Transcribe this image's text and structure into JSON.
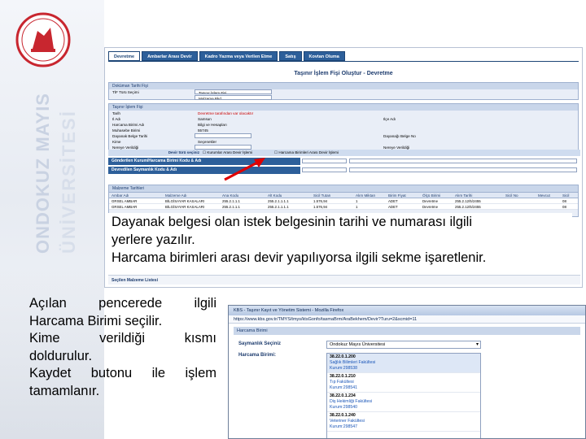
{
  "university": {
    "vertical_name_line1": "ONDOKUZ MAYIS",
    "vertical_name_line2": "ÜNİVERSİTESİ",
    "colors": {
      "logo_red": "#c8262f",
      "band_text": "#c9d2e2"
    }
  },
  "screen": {
    "tabs": [
      "Devretme",
      "Ambarlar Arası Devir",
      "Kadro Yazma veya Verilen Etme",
      "Satış",
      "Kovtan Oluma"
    ],
    "form_title": "Taşınır İşlem Fişi Oluştur - Devretme",
    "sections": {
      "doc_info": "Doküman Tarihi Fişi",
      "fis_info": "Taşınır İşlem Fişi"
    },
    "fields": [
      {
        "label": "TİF Türü Seçimi",
        "value": "Taşınır İşlem Fişi"
      },
      {
        "label": "Malzeme Bkd",
        "value": "Malzeme Bkd"
      },
      {
        "label": "Tarih",
        "value": "Devretme tarafından var olacaktır"
      },
      {
        "label": "Il Adı",
        "value": "Samsun"
      },
      {
        "label": "Harcama Birimi Adı",
        "value": "Bilgi ve Hesapları"
      },
      {
        "label": "Muhasebe Birimi",
        "value": "55745"
      },
      {
        "label": "Dayanak Belge Tarihi",
        "value": ""
      },
      {
        "label": "Kime",
        "value": "Seçenekler"
      },
      {
        "label": "Nereye Verildiği",
        "value": ""
      }
    ],
    "right_labels": [
      "Ilçe Adı",
      "Dayanağı Belge No",
      "Nereye Verildiği"
    ],
    "devir_row_label": "Devir türü seçiniz",
    "devir_options": [
      "Kurumlar Arası Devir İşlemi",
      "Harcama Birimleri Arası Devir İşlemi"
    ],
    "blue_bars": [
      "Gönderilen Kurum/Harcama Birimi Kodu & Adı",
      "Devredilen Saymanlık Kodu & Adı"
    ],
    "table_section": "Malzeme Tarihleri",
    "table_headers": [
      "Ambar Adı",
      "Malzeme Adı",
      "Ana Kodu",
      "Alt Kodu",
      "Sicil Tutarı",
      "Alım Miktarı",
      "Birim Fiyat",
      "Ölçü Birimi",
      "Alım Tarihi",
      "Sicil No",
      "Mevcut",
      "Sicil"
    ],
    "table_rows": [
      [
        "GRSEL AMBAR",
        "BİLGİSAYAR KASALARI",
        "255.2.1.1.1",
        "255.2.1.1.1.1",
        "1.576,94",
        "1",
        "ADET",
        "Devretme",
        "255.2.12/5/2455",
        "",
        "",
        "08"
      ],
      [
        "GRSEL AMBAR",
        "BİLGİSAYAR KASALARI",
        "255.2.1.1.1",
        "255.2.1.1.1.1",
        "1.576,94",
        "1",
        "ADET",
        "Devretme",
        "255.2.12/5/2455",
        "",
        "",
        "08"
      ]
    ],
    "bottom_strip": "Seçilen Malzeme Listesi"
  },
  "note": {
    "line1": "Dayanak belgesi olan istek belgesinin tarihi ve numarası ilgili",
    "line2": "yerlere yazılır.",
    "line3": "Harcama birimleri arası devir yapılıyorsa ilgili sekme işaretlenir."
  },
  "instructions": {
    "l1": "Açılan pencerede ilgili",
    "l2": "Harcama Birimi seçilir.",
    "l3": "Kime verildiği kısmı",
    "l4": "doldurulur.",
    "l5": "Kaydet butonu ile işlem",
    "l6": "tamamlanır."
  },
  "popup": {
    "title": "KBS - Taşınır Kayıt ve Yönetim Sistemi - Mozilla Firefox",
    "url": "https://www.kbs.gov.tr/TMYS/tmys/ktsGonfo/tasmaBrm/AraBekhem/Devir?Turu=2&scmid=11",
    "section": "Harcama Birimi",
    "saymanlik_label": "Saymanlık Seçiniz",
    "harcama_label": "Harcama Birimi:",
    "selected": "Ondokuz Mayıs Üniversitesi",
    "items": [
      {
        "code": "38.22.0.1.200",
        "name": "Sağlık Bilimleri Fakültesi",
        "kurum": "Kurum:298538"
      },
      {
        "code": "38.22.0.1.210",
        "name": "Tıp Fakültesi",
        "kurum": "Kurum:298541"
      },
      {
        "code": "38.22.0.1.234",
        "name": "Diş Hekimliği Fakültesi",
        "kurum": "Kurum:298540"
      },
      {
        "code": "38.22.0.1.240",
        "name": "Veteriner Fakültesi",
        "kurum": "Kurum:298547"
      }
    ]
  }
}
